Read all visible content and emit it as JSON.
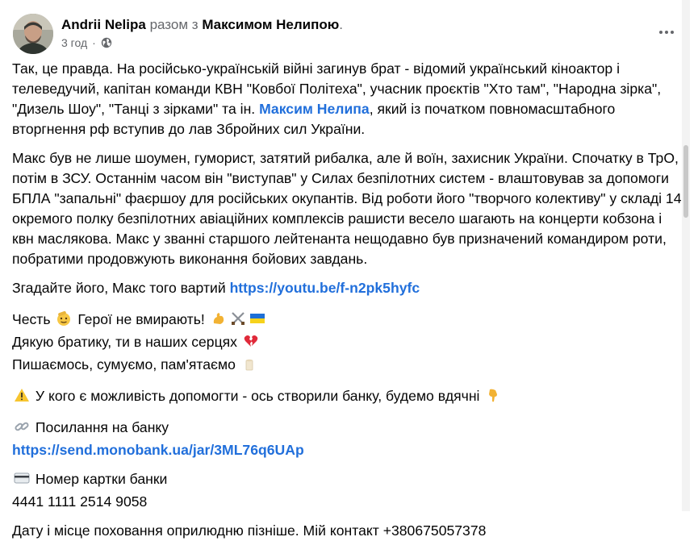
{
  "post": {
    "author": "Andrii Nelipa",
    "with_text": "разом з",
    "tagged_person": "Максимом Нелипою",
    "tagged_suffix": ".",
    "time": "3 год",
    "separator": "·",
    "privacy_icon": "globe-icon",
    "more_icon": "more-options-icon"
  },
  "body": {
    "p1_start": "Так, це правда. На російсько-українській війні загинув брат - відомий український кіноактор і телеведучий, капітан команди КВН \"Ковбої Політеха\", учасник проєктів \"Хто там\", \"Народна зірка\", \"Дизель Шоу\", \"Танці з зірками\" та ін. ",
    "p1_mention": "Максим Нелипа",
    "p1_end": ", який із початком повномасштабного вторгнення рф вступив до лав Збройних сил України.",
    "p2": "Макс був не лише шоумен, гуморист, затятий рибалка, але й воїн, захисник України. Спочатку в ТрО, потім в ЗСУ. Останнім часом він \"виступав\" у Силах безпілотних систем - влаштовував за допомоги БПЛА \"запальні\" фаєршоу для російських окупантів. Від роботи його \"творчого колективу\" у складі 14 окремого полку безпілотних авіаційних комплексів рашисти весело шагають на концерти кобзона і квн маслякова. Макс у званні старшого лейтенанта нещодавно був призначений командиром роти, побратими продовжують виконання бойових завдань.",
    "p3_text": "Згадайте його, Макс того вартий ",
    "p3_link": "https://youtu.be/f-n2pk5hyfc",
    "p4_line1": "Честь",
    "p4_line1b": "Герої не вмирають!",
    "p4_line2": "Дякую братику, ти в наших серцях",
    "p4_line3": "Пишаємось, сумуємо, пам'ятаємо",
    "p5": "У кого є можливість допомогти - ось створили банку, будемо вдячні",
    "p6_label": "Посилання на банку",
    "p6_link": "https://send.monobank.ua/jar/3ML76q6UAp",
    "p7_label": "Номер картки банки",
    "p7_number": "4441 1111 2514 9058",
    "p8": "Дату і місце поховання оприлюдню пізніше. Мій контакт +380675057378"
  }
}
